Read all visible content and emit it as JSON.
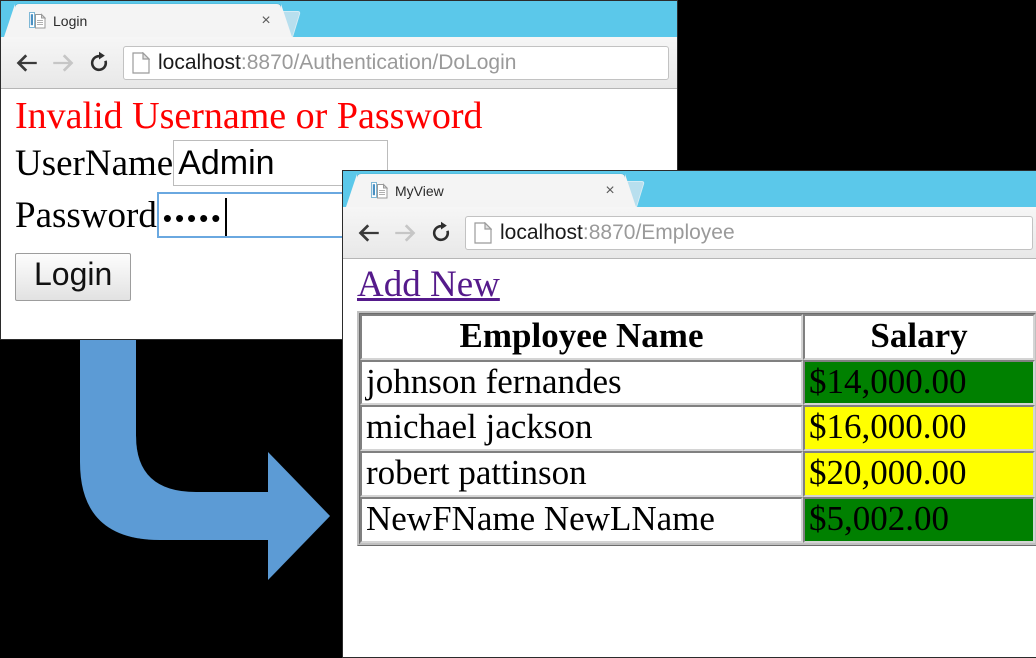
{
  "colors": {
    "browser_chrome": "#5bc8ea",
    "arrow": "#5b9bd5",
    "error_text": "#ff0000",
    "link": "#551a8b",
    "salary_green": "#008000",
    "salary_yellow": "#ffff00",
    "page_background": "#000000"
  },
  "login_window": {
    "tab": {
      "title": "Login",
      "favicon": "page-icon",
      "close_label": "×"
    },
    "toolbar": {
      "back_icon": "back-arrow-icon",
      "forward_icon": "forward-arrow-icon",
      "reload_icon": "reload-icon",
      "page_icon": "page-icon",
      "url_host": "localhost",
      "url_path": ":8870/Authentication/DoLogin"
    },
    "page": {
      "error_message": "Invalid Username or Password",
      "fields": [
        {
          "label": "UserName",
          "value": "Admin",
          "type": "text",
          "focused": false
        },
        {
          "label": "Password",
          "value": "•••••",
          "type": "password",
          "focused": true
        }
      ],
      "submit_label": "Login"
    }
  },
  "employee_window": {
    "tab": {
      "title": "MyView",
      "favicon": "page-icon",
      "close_label": "×"
    },
    "toolbar": {
      "back_icon": "back-arrow-icon",
      "forward_icon": "forward-arrow-icon",
      "reload_icon": "reload-icon",
      "page_icon": "page-icon",
      "url_host": "localhost",
      "url_path": ":8870/Employee"
    },
    "page": {
      "add_new_label": "Add New",
      "table": {
        "headers": [
          "Employee Name",
          "Salary"
        ],
        "rows": [
          {
            "name": "johnson fernandes",
            "salary": "$14,000.00",
            "salary_bg": "#008000"
          },
          {
            "name": "michael jackson",
            "salary": "$16,000.00",
            "salary_bg": "#ffff00"
          },
          {
            "name": "robert pattinson",
            "salary": "$20,000.00",
            "salary_bg": "#ffff00"
          },
          {
            "name": "NewFName NewLName",
            "salary": "$5,002.00",
            "salary_bg": "#008000"
          }
        ]
      }
    }
  },
  "annotation": {
    "arrow_icon": "curved-flow-arrow"
  }
}
